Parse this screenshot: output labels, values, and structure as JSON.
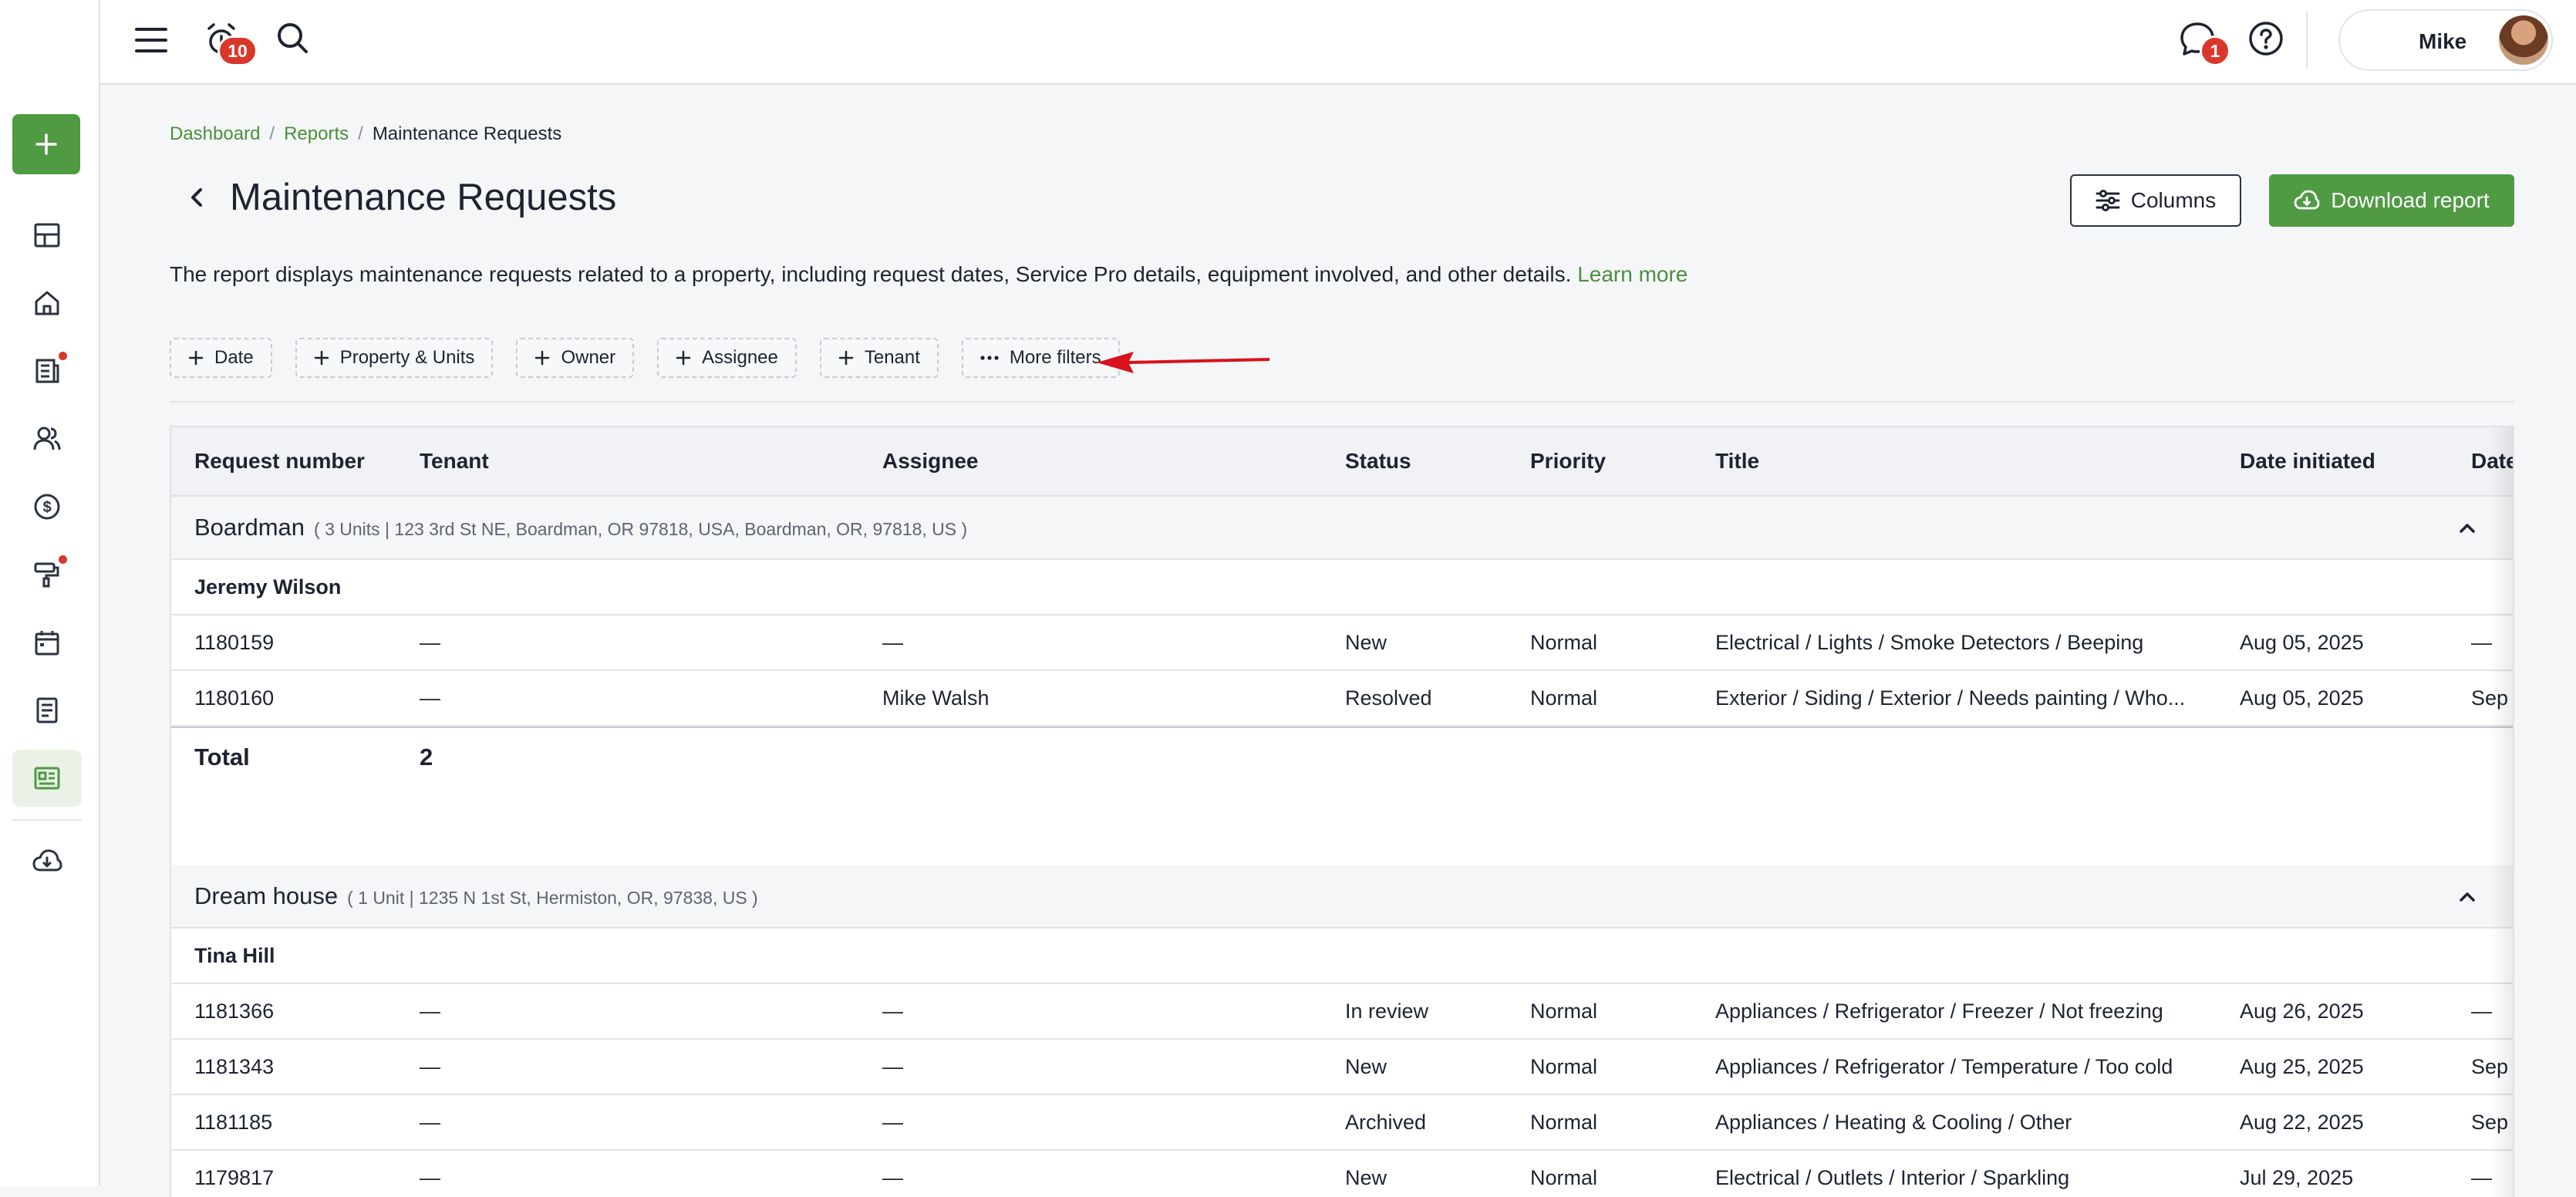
{
  "topbar": {
    "notifications_count": "10",
    "messages_count": "1",
    "user_name": "Mike"
  },
  "sidebar": {
    "add_label": "+",
    "items": [
      "dashboard-icon",
      "home-icon",
      "news-icon",
      "people-icon",
      "dollar-icon",
      "paint-roller-icon",
      "calendar-icon",
      "document-icon",
      "reports-icon",
      "cloud-download-icon"
    ]
  },
  "breadcrumb": {
    "items": [
      "Dashboard",
      "Reports"
    ],
    "current": "Maintenance Requests",
    "separator": "/"
  },
  "page": {
    "title": "Maintenance Requests",
    "description": "The report displays maintenance requests related to a property, including request dates, Service Pro details, equipment involved, and other details.",
    "learn_more": "Learn more",
    "columns_button": "Columns",
    "download_button": "Download report"
  },
  "filters": [
    "Date",
    "Property & Units",
    "Owner",
    "Assignee",
    "Tenant"
  ],
  "more_filters": "More filters",
  "table": {
    "headers": [
      "Request number",
      "Tenant",
      "Assignee",
      "Status",
      "Priority",
      "Title",
      "Date initiated",
      "Date"
    ],
    "groups": [
      {
        "name": "Boardman",
        "meta": "( 3 Units | 123 3rd St NE, Boardman, OR 97818, USA, Boardman, OR, 97818, US )",
        "tenant": "Jeremy Wilson",
        "rows": [
          [
            "1180159",
            "—",
            "—",
            "New",
            "Normal",
            "Electrical / Lights / Smoke Detectors / Beeping",
            "Aug 05, 2025",
            "—"
          ],
          [
            "1180160",
            "—",
            "Mike Walsh",
            "Resolved",
            "Normal",
            "Exterior / Siding / Exterior / Needs painting / Who...",
            "Aug 05, 2025",
            "Sep"
          ]
        ],
        "total_label": "Total",
        "total_value": "2"
      },
      {
        "name": "Dream house",
        "meta": "( 1 Unit | 1235 N 1st St, Hermiston, OR, 97838, US )",
        "tenant": "Tina Hill",
        "rows": [
          [
            "1181366",
            "—",
            "—",
            "In review",
            "Normal",
            "Appliances / Refrigerator / Freezer / Not freezing",
            "Aug 26, 2025",
            "—"
          ],
          [
            "1181343",
            "—",
            "—",
            "New",
            "Normal",
            "Appliances / Refrigerator / Temperature / Too cold",
            "Aug 25, 2025",
            "Sep"
          ],
          [
            "1181185",
            "—",
            "—",
            "Archived",
            "Normal",
            "Appliances / Heating & Cooling / Other",
            "Aug 22, 2025",
            "Sep"
          ],
          [
            "1179817",
            "—",
            "—",
            "New",
            "Normal",
            "Electrical / Outlets / Interior / Sparkling",
            "Jul 29, 2025",
            "—"
          ]
        ]
      }
    ]
  },
  "colors": {
    "brand_green": "#4f9a43",
    "link_green": "#4a8f3c",
    "badge_red": "#d9372b",
    "annotation_arrow": "#d8121c"
  }
}
